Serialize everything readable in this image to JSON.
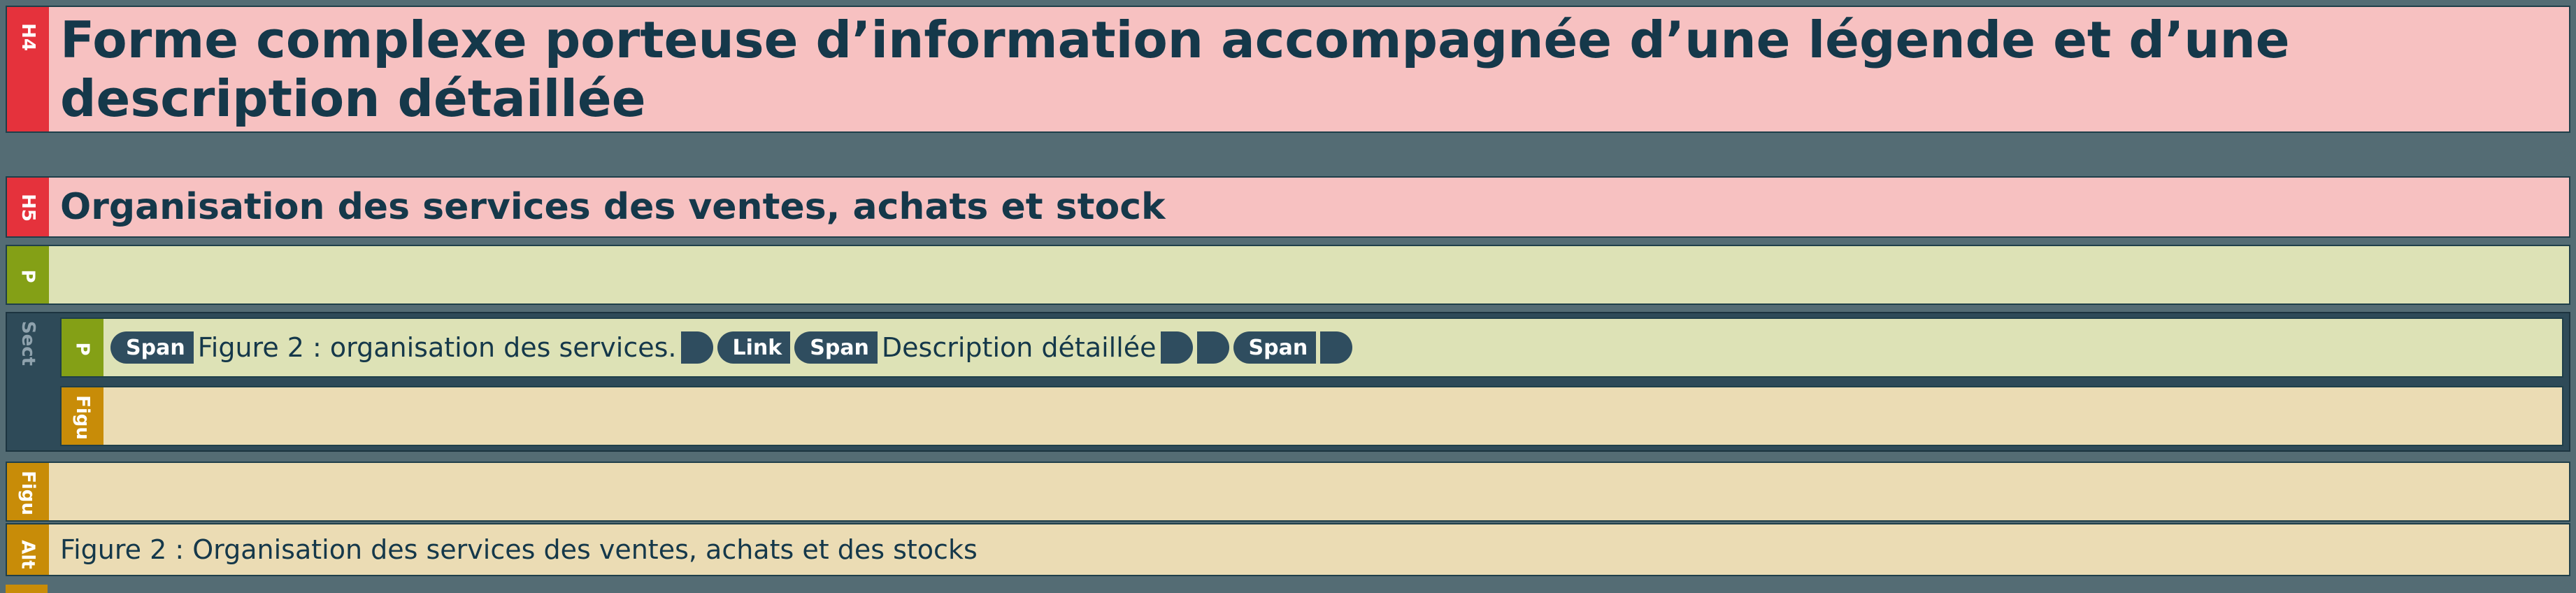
{
  "h4": {
    "tag": "H4",
    "text": "Forme complexe porteuse d’information accompagnée d’une légende et d’une description détaillée"
  },
  "h5": {
    "tag": "H5",
    "text": "Organisation des services des ventes, achats et stock"
  },
  "p_empty": {
    "tag": "P"
  },
  "sect": {
    "tag": "Sect",
    "p": {
      "tag": "P",
      "span1_label": "Span",
      "span1_text": "Figure 2 : organisation des services.",
      "link_label": "Link",
      "span2_label": "Span",
      "span2_text": "Description détaillée",
      "span3_label": "Span"
    },
    "figure": {
      "tag": "Figu"
    }
  },
  "figure": {
    "tag": "Figu"
  },
  "alt": {
    "tag": "Alt",
    "text": "Figure 2 : Organisation des services des ventes, achats et des stocks"
  }
}
